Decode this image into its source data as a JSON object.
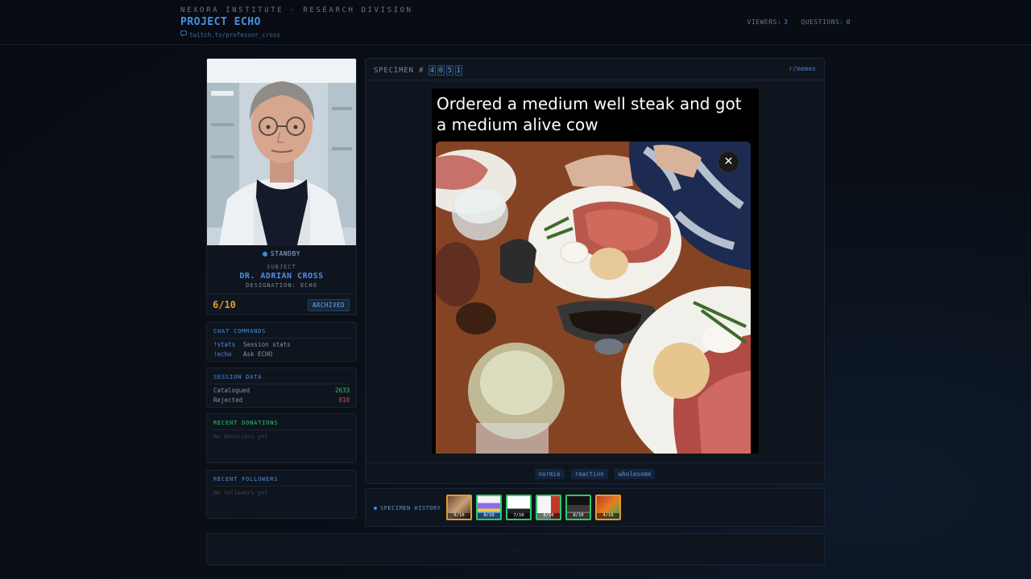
{
  "header": {
    "org": "NEXORA INSTITUTE · RESEARCH DIVISION",
    "project": "PROJECT ECHO",
    "link": "twitch.tv/professor_cross",
    "viewers_label": "VIEWERS:",
    "viewers": "3",
    "questions_label": "QUESTIONS:",
    "questions": "0"
  },
  "profile": {
    "status": "STANDBY",
    "subject_label": "SUBJECT",
    "name": "DR. ADRIAN CROSS",
    "designation": "DESIGNATION: ECHO",
    "score": "6/10",
    "badge": "ARCHIVED"
  },
  "commands": {
    "title": "CHAT COMMANDS",
    "items": [
      {
        "key": "!stats",
        "desc": "Session stats"
      },
      {
        "key": "!echo",
        "desc": "Ask ECHO"
      }
    ]
  },
  "session": {
    "title": "SESSION DATA",
    "catalogued_label": "Catalogued",
    "catalogued": "2633",
    "rejected_label": "Rejected",
    "rejected": "810"
  },
  "donations": {
    "title": "RECENT DONATIONS",
    "empty": "No donations yet"
  },
  "followers": {
    "title": "RECENT FOLLOWERS",
    "empty": "No followers yet"
  },
  "specimen": {
    "label": "SPECIMEN #",
    "digits": [
      "4",
      "0",
      "5",
      "1"
    ],
    "subreddit": "r/memes",
    "caption": "Ordered a medium well steak and got a medium alive cow",
    "close_glyph": "✕",
    "tags": [
      "normie",
      "reaction",
      "wholesome"
    ]
  },
  "history": {
    "label": "SPECIMEN HISTORY",
    "items": [
      {
        "score": "6/10",
        "state": "warn"
      },
      {
        "score": "8/10",
        "state": "ok"
      },
      {
        "score": "7/10",
        "state": "ok"
      },
      {
        "score": "8/10",
        "state": "ok"
      },
      {
        "score": "8/10",
        "state": "ok"
      },
      {
        "score": "4/10",
        "state": "warn"
      }
    ]
  },
  "footer": {
    "dots": "..."
  },
  "colors": {
    "accent": "#4a8fe6",
    "score": "#e59a2f",
    "ok": "#2fc76b",
    "bad": "#d64545"
  }
}
